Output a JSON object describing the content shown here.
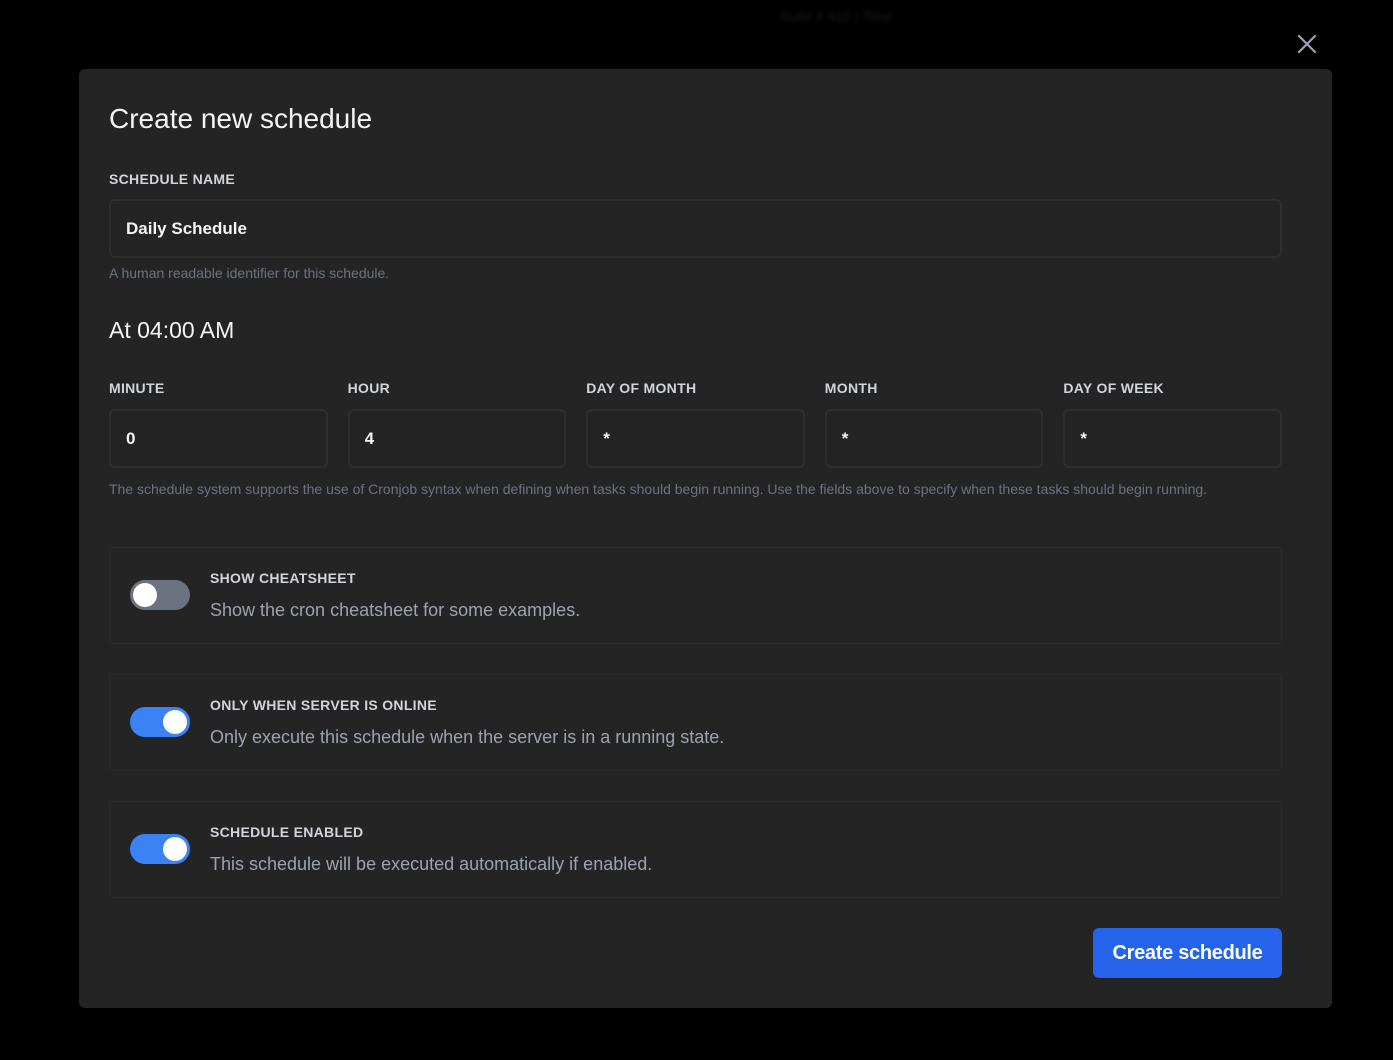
{
  "background": {
    "blurred_text": "Suite # 410 | Time"
  },
  "modal": {
    "title": "Create new schedule",
    "schedule_name": {
      "label": "SCHEDULE NAME",
      "value": "Daily Schedule",
      "hint": "A human readable identifier for this schedule."
    },
    "time_summary": "At 04:00 AM",
    "cron": {
      "fields": [
        {
          "label": "MINUTE",
          "value": "0"
        },
        {
          "label": "HOUR",
          "value": "4"
        },
        {
          "label": "DAY OF MONTH",
          "value": "*"
        },
        {
          "label": "MONTH",
          "value": "*"
        },
        {
          "label": "DAY OF WEEK",
          "value": "*"
        }
      ],
      "hint": "The schedule system supports the use of Cronjob syntax when defining when tasks should begin running. Use the fields above to specify when these tasks should begin running."
    },
    "toggles": [
      {
        "title": "SHOW CHEATSHEET",
        "description": "Show the cron cheatsheet for some examples.",
        "enabled": false
      },
      {
        "title": "ONLY WHEN SERVER IS ONLINE",
        "description": "Only execute this schedule when the server is in a running state.",
        "enabled": true
      },
      {
        "title": "SCHEDULE ENABLED",
        "description": "This schedule will be executed automatically if enabled.",
        "enabled": true
      }
    ],
    "submit_label": "Create schedule"
  },
  "icons": {
    "close": "close-icon"
  },
  "colors": {
    "background": "#000000",
    "modal": "#242424",
    "accent": "#3b82f6",
    "button": "#2563eb",
    "toggle_off": "#6b7280"
  }
}
